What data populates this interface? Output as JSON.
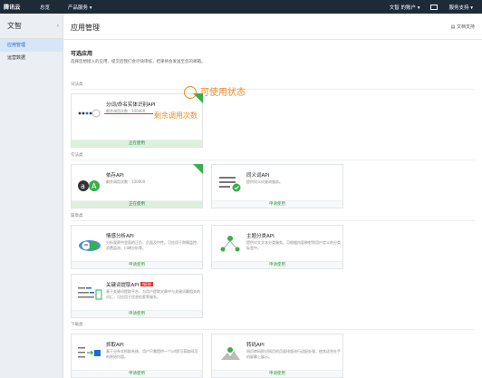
{
  "topbar": {
    "logo": "腾讯云",
    "nav_home": "总览",
    "nav_products": "产品服务 ▾",
    "user": "文智 的账户 ▾",
    "support": "服务支持 ▾"
  },
  "sidebar": {
    "title": "文智",
    "collapse": "‹",
    "items": [
      {
        "label": "应用管理",
        "active": true
      },
      {
        "label": "运营数据",
        "active": false
      }
    ]
  },
  "main": {
    "title": "应用管理",
    "doc_link": "文档支持",
    "section_title": "可选应用",
    "section_desc": "选择您想接入的应用，提交后我们会尽快审核，结果将会发送至您的邮箱。",
    "groups": {
      "g1": "词法类",
      "g2": "句法类",
      "g3": "篇章类",
      "g4": "下载类"
    },
    "cards": {
      "ner": {
        "name": "分词/命名实体识别API",
        "desc": "剩余调用次数：100000",
        "status": "正在使用"
      },
      "dep": {
        "name": "依存API",
        "desc": "剩余调用次数：100000",
        "status": "正在使用"
      },
      "syn": {
        "name": "同义词API",
        "desc": "提供同义词查询服务。",
        "status": "申请使用"
      },
      "sent": {
        "name": "情感分析API",
        "desc": "分析观察中里面的正负、负面及中性。可应用于舆情监控、消费监测、口碑分析等。",
        "status": "申请使用"
      },
      "topic": {
        "name": "主题分类API",
        "desc": "提供对文文本分类服务，可根据内容映射到用户定义的分类标签中。",
        "status": "申请使用"
      },
      "kw": {
        "name": "关键词提取API",
        "badge": "NEW",
        "desc": "基于关键词提取平台，为用户提取文章中与关键词最相关的词汇，可应用于信息检索等服务。",
        "status": "申请使用"
      },
      "crawl": {
        "name": "抓取API",
        "desc": "基于分布式抓取系统，用户只需提供一个url即可获取网页的原始内容。",
        "status": "申请使用"
      },
      "transcode": {
        "name": "转码API",
        "desc": "网页转码即对网页的页面排版进行适配处理，使其适合在手机屏幕上展示。",
        "status": "申请使用"
      }
    }
  },
  "annotations": {
    "status": "可使用状态",
    "remaining": "剩余调用次数"
  },
  "colors": {
    "accent_green": "#35b04a",
    "annotation_orange": "#f08a24",
    "annotation_red": "#e53935",
    "link_blue": "#1c6ad6"
  }
}
